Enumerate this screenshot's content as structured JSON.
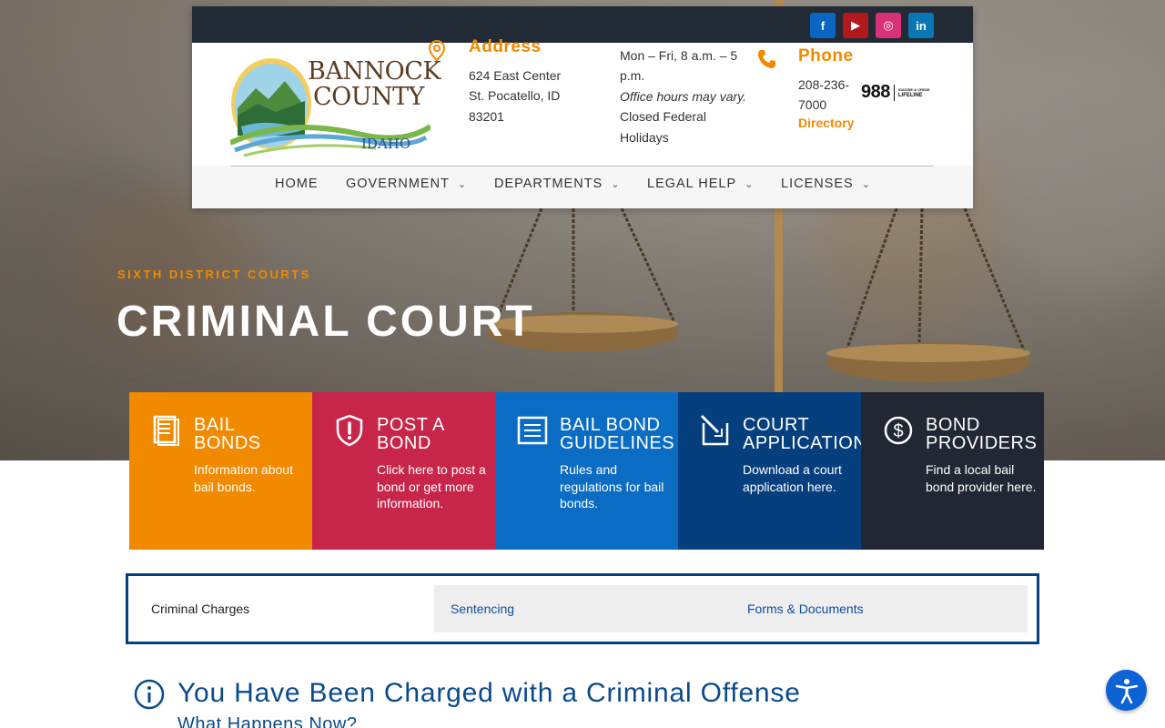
{
  "social": {
    "facebook": "f",
    "youtube": "▶",
    "instagram": "◎",
    "linkedin": "in"
  },
  "logo": {
    "line1": "BANNOCK",
    "line2": "COUNTY",
    "line3": "IDAHO"
  },
  "address": {
    "title": "Address",
    "lines": "624 East Center St. Pocatello, ID 83201"
  },
  "hours": {
    "line1": "Mon – Fri, 8 a.m. – 5 p.m.",
    "line2": "Office hours may vary.",
    "line3": "Closed Federal Holidays"
  },
  "phone": {
    "title": "Phone",
    "number": "208-236-7000",
    "directory": "Directory",
    "lifeline_number": "988",
    "lifeline_text_top": "SUICIDE & CRISIS",
    "lifeline_text_bottom": "LIFELINE"
  },
  "nav": {
    "home": "HOME",
    "government": "GOVERNMENT",
    "departments": "DEPARTMENTS",
    "legal_help": "LEGAL HELP",
    "licenses": "LICENSES"
  },
  "hero": {
    "kicker": "SIXTH DISTRICT COURTS",
    "title": "CRIMINAL COURT"
  },
  "tiles": [
    {
      "title": "BAIL\nBONDS",
      "desc": "Information about bail bonds.",
      "icon": "document-icon",
      "color": "#f28a00"
    },
    {
      "title": "POST A\nBOND",
      "desc": "Click here to post a bond or get more information.",
      "icon": "alert-icon",
      "color": "#c7264a"
    },
    {
      "title": "BAIL BOND\nGUIDELINES",
      "desc": "Rules and regulations for bail bonds.",
      "icon": "list-icon",
      "color": "#0b6cc4"
    },
    {
      "title": "COURT\nAPPLICATIONS",
      "desc": "Download a court application here.",
      "icon": "edit-icon",
      "color": "#063f7e"
    },
    {
      "title": "BOND\nPROVIDERS",
      "desc": "Find a local bail bond provider here.",
      "icon": "dollar-icon",
      "color": "#212833"
    }
  ],
  "tabs": {
    "criminal_charges": "Criminal Charges",
    "sentencing": "Sentencing",
    "forms_documents": "Forms & Documents"
  },
  "section": {
    "title": "You Have Been Charged with a Criminal Offense",
    "subtitle": "What Happens Now?"
  }
}
